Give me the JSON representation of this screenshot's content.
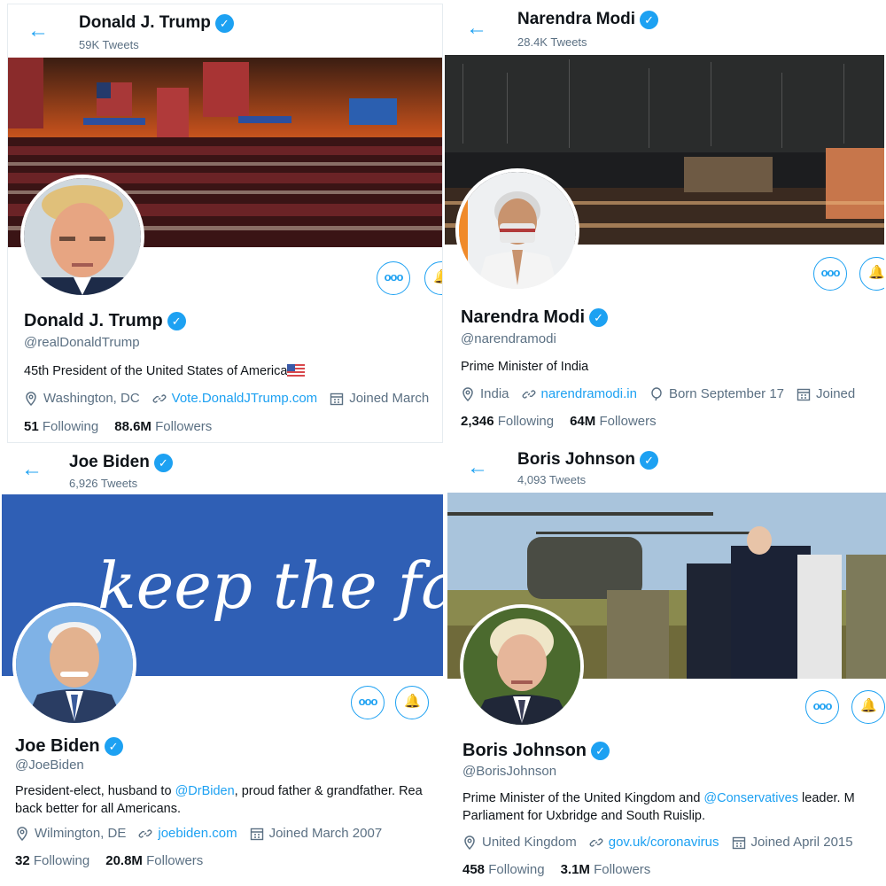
{
  "profiles": [
    {
      "header_name": "Donald J. Trump",
      "tweet_count": "59K Tweets",
      "name": "Donald J. Trump",
      "handle": "@realDonaldTrump",
      "bio": "45th President of the United States of America",
      "bio_emoji": "us-flag-icon",
      "location": "Washington, DC",
      "website": "Vote.DonaldJTrump.com",
      "joined": "Joined March",
      "following_count": "51",
      "following_label": "Following",
      "followers_count": "88.6M",
      "followers_label": "Followers"
    },
    {
      "header_name": "Narendra Modi",
      "tweet_count": "28.4K Tweets",
      "name": "Narendra Modi",
      "handle": "@narendramodi",
      "bio": "Prime Minister of India",
      "location": "India",
      "website": "narendramodi.in",
      "born": "Born September 17",
      "joined": "Joined",
      "following_count": "2,346",
      "following_label": "Following",
      "followers_count": "64M",
      "followers_label": "Followers"
    },
    {
      "header_name": "Joe Biden",
      "tweet_count": "6,926 Tweets",
      "banner_text": "keep the faith.",
      "name": "Joe Biden",
      "handle": "@JoeBiden",
      "bio_pre": "President-elect, husband to ",
      "bio_mention": "@DrBiden",
      "bio_post": ", proud father & grandfather. Rea",
      "bio_line2": "back better for all Americans.",
      "location": "Wilmington, DE",
      "website": "joebiden.com",
      "joined": "Joined March 2007",
      "following_count": "32",
      "following_label": "Following",
      "followers_count": "20.8M",
      "followers_label": "Followers"
    },
    {
      "header_name": "Boris Johnson",
      "tweet_count": "4,093 Tweets",
      "name": "Boris Johnson",
      "handle": "@BorisJohnson",
      "bio_pre": "Prime Minister of the United Kingdom and ",
      "bio_mention": "@Conservatives",
      "bio_post": " leader. M",
      "bio_line2": "Parliament for Uxbridge and South Ruislip.",
      "location": "United Kingdom",
      "website": "gov.uk/coronavirus",
      "joined": "Joined April 2015",
      "following_count": "458",
      "following_label": "Following",
      "followers_count": "3.1M",
      "followers_label": "Followers"
    }
  ],
  "ui": {
    "back_arrow": "←",
    "verified_mark": "✓",
    "more_button": "ooo",
    "bell_button": "🔔",
    "accent": "#1da1f2",
    "muted": "#5b7083"
  }
}
